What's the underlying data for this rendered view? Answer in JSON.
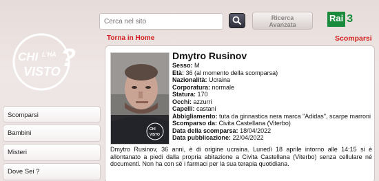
{
  "logo": {
    "text": "CHI L'HA VISTO?"
  },
  "search": {
    "placeholder": "Cerca nel sito",
    "advanced_label_line1": "Ricerca",
    "advanced_label_line2": "Avanzata"
  },
  "rai": {
    "label": "Rai",
    "number": "3"
  },
  "nav": {
    "home_link": "Torna in Home",
    "section_title": "Scomparsi"
  },
  "sidebar": {
    "items": [
      {
        "label": "Scomparsi"
      },
      {
        "label": "Bambini"
      },
      {
        "label": "Misteri"
      },
      {
        "label": "Dove Sei ?"
      }
    ]
  },
  "person": {
    "name": "Dmytro Rusinov",
    "fields": [
      {
        "label": "Sesso:",
        "value": "M"
      },
      {
        "label": "Età:",
        "value": "36 (al momento della scomparsa)"
      },
      {
        "label": "Nazionalità:",
        "value": "Ucraina"
      },
      {
        "label": "Corporatura:",
        "value": "normale"
      },
      {
        "label": "Statura:",
        "value": "170"
      },
      {
        "label": "Occhi:",
        "value": "azzurri"
      },
      {
        "label": "Capelli:",
        "value": "castani"
      },
      {
        "label": "Abbigliamento:",
        "value": "tuta da ginnastica nera marca \"Adidas\", scarpe marroni"
      },
      {
        "label": "Scomparso da:",
        "value": "Civita Castellana (Viterbo)"
      },
      {
        "label": "Data della scomparsa:",
        "value": "18/04/2022"
      },
      {
        "label": "Data pubblicazione:",
        "value": "22/04/2022"
      }
    ],
    "description": "Dmytro Rusinov, 36 anni, è di origine ucraina. Lunedì 18 aprile intorno alle 14:15 si è allontanato a piedi dalla propria abitazione a Civita Castellana (Viterbo) senza cellulare né documenti. Non ha con sé i farmaci per la sua terapia quotidiana."
  },
  "colors": {
    "accent_red": "#d21e1e",
    "rai_green": "#1a8a3c"
  }
}
